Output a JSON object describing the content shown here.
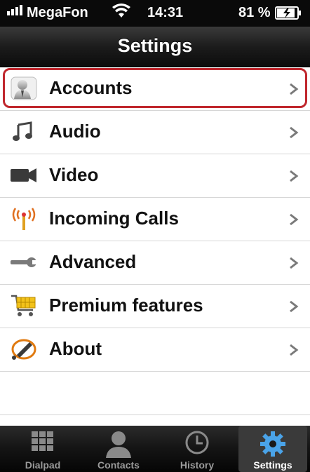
{
  "status_bar": {
    "carrier": "MegaFon",
    "time": "14:31",
    "battery": "81 %"
  },
  "nav": {
    "title": "Settings"
  },
  "menu": {
    "items": [
      {
        "label": "Accounts",
        "icon": "person-icon"
      },
      {
        "label": "Audio",
        "icon": "music-note-icon"
      },
      {
        "label": "Video",
        "icon": "video-camera-icon"
      },
      {
        "label": "Incoming Calls",
        "icon": "antenna-icon"
      },
      {
        "label": "Advanced",
        "icon": "wrench-icon"
      },
      {
        "label": "Premium features",
        "icon": "shopping-cart-icon"
      },
      {
        "label": "About",
        "icon": "info-swirl-icon"
      }
    ],
    "highlight_color": "#c0272d"
  },
  "tabbar": {
    "tabs": [
      {
        "label": "Dialpad",
        "icon": "dialpad-icon"
      },
      {
        "label": "Contacts",
        "icon": "contact-silhouette-icon"
      },
      {
        "label": "History",
        "icon": "clock-icon"
      },
      {
        "label": "Settings",
        "icon": "gear-icon",
        "active": true
      }
    ]
  }
}
